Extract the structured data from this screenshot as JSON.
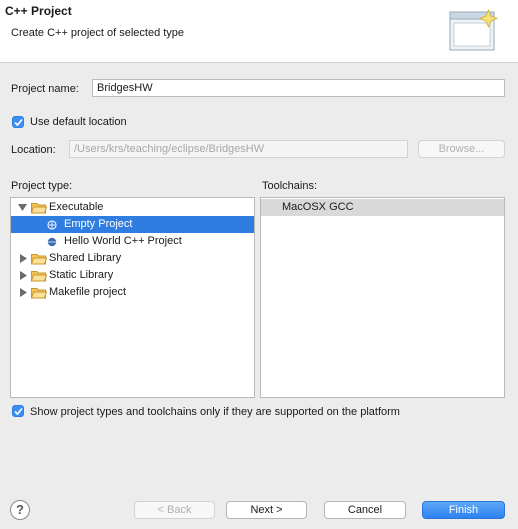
{
  "header": {
    "title": "C++ Project",
    "description": "Create C++ project of selected type"
  },
  "project_name": {
    "label": "Project name:",
    "value": "BridgesHW"
  },
  "use_default_location": {
    "label": "Use default location",
    "checked": true
  },
  "location": {
    "label": "Location:",
    "value": "/Users/krs/teaching/eclipse/BridgesHW",
    "browse_label": "Browse..."
  },
  "project_type": {
    "label": "Project type:",
    "items": [
      {
        "label": "Executable",
        "expanded": true
      },
      {
        "label": "Empty Project",
        "selected": true
      },
      {
        "label": "Hello World C++ Project"
      },
      {
        "label": "Shared Library"
      },
      {
        "label": "Static Library"
      },
      {
        "label": "Makefile project"
      }
    ]
  },
  "toolchains": {
    "label": "Toolchains:",
    "items": [
      "MacOSX GCC"
    ]
  },
  "show_supported": {
    "label": "Show project types and toolchains only if they are supported on the platform",
    "checked": true
  },
  "buttons": {
    "help": "?",
    "back": "< Back",
    "next": "Next >",
    "cancel": "Cancel",
    "finish": "Finish"
  },
  "colors": {
    "accent": "#2f7de1",
    "finish": "#2b82ef"
  }
}
